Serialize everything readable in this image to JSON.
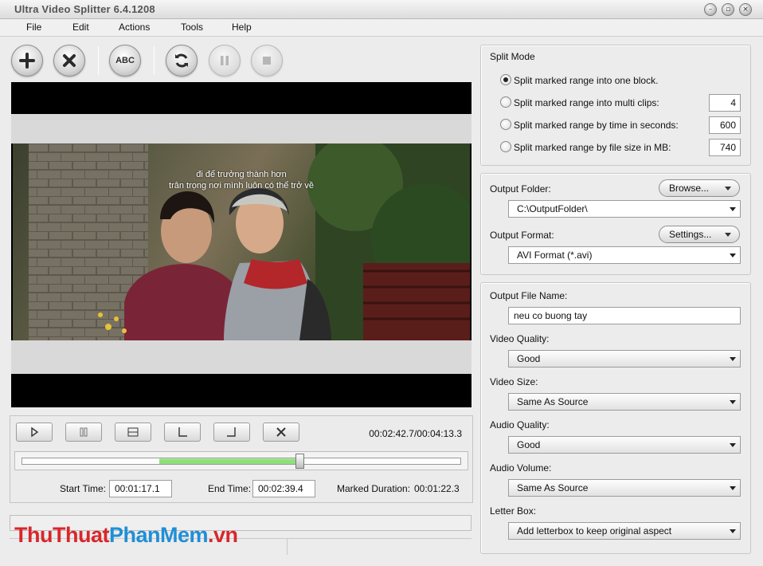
{
  "window": {
    "title": "Ultra Video Splitter 6.4.1208",
    "controls": [
      "minimize",
      "restore",
      "close"
    ]
  },
  "menu": [
    "File",
    "Edit",
    "Actions",
    "Tools",
    "Help"
  ],
  "toolbar": {
    "buttons": [
      {
        "name": "add",
        "icon": "plus-icon"
      },
      {
        "name": "remove",
        "icon": "x-icon"
      },
      {
        "name": "rename",
        "icon": "abc-icon",
        "text": "ABC"
      },
      {
        "name": "convert",
        "icon": "refresh-icon"
      },
      {
        "name": "pause",
        "icon": "pause-icon",
        "disabled": true
      },
      {
        "name": "stop",
        "icon": "stop-icon",
        "disabled": true
      }
    ]
  },
  "video": {
    "subtitle_line1": "đi để trưởng thành hơn",
    "subtitle_line2": "trân trọng nơi mình luôn có thể trở về"
  },
  "playback": {
    "current_time": "00:02:42.7/00:04:13.3",
    "range_start_fraction": 0.313,
    "range_end_fraction": 0.635,
    "start_time_label": "Start Time:",
    "start_time": "00:01:17.1",
    "end_time_label": "End Time:",
    "end_time": "00:02:39.4",
    "marked_duration_label": "Marked Duration:",
    "marked_duration": "00:01:22.3"
  },
  "split_mode": {
    "title": "Split Mode",
    "options": [
      {
        "label": "Split  marked range into one block.",
        "checked": true,
        "value": ""
      },
      {
        "label": "Split marked range into multi clips:",
        "checked": false,
        "value": "4"
      },
      {
        "label": "Split marked range by time in seconds:",
        "checked": false,
        "value": "600"
      },
      {
        "label": "Split marked range by file size in MB:",
        "checked": false,
        "value": "740"
      }
    ]
  },
  "output": {
    "folder_label": "Output Folder:",
    "browse_label": "Browse...",
    "folder_value": "C:\\OutputFolder\\",
    "format_label": "Output Format:",
    "settings_label": "Settings...",
    "format_value": "AVI Format (*.avi)"
  },
  "options": {
    "file_name_label": "Output File Name:",
    "file_name": "neu co buong tay",
    "video_quality_label": "Video Quality:",
    "video_quality": "Good",
    "video_size_label": "Video Size:",
    "video_size": "Same As Source",
    "audio_quality_label": "Audio Quality:",
    "audio_quality": "Good",
    "audio_volume_label": "Audio Volume:",
    "audio_volume": "Same As Source",
    "letterbox_label": "Letter Box:",
    "letterbox": "Add letterbox to keep original aspect"
  },
  "watermark": {
    "part1": "ThuThuat",
    "part2": "PhanMem",
    "part3": ".vn"
  },
  "colors": {
    "watermark_red": "#d9262b",
    "watermark_blue": "#1f8fd6",
    "range_green": "#8fe07a"
  }
}
